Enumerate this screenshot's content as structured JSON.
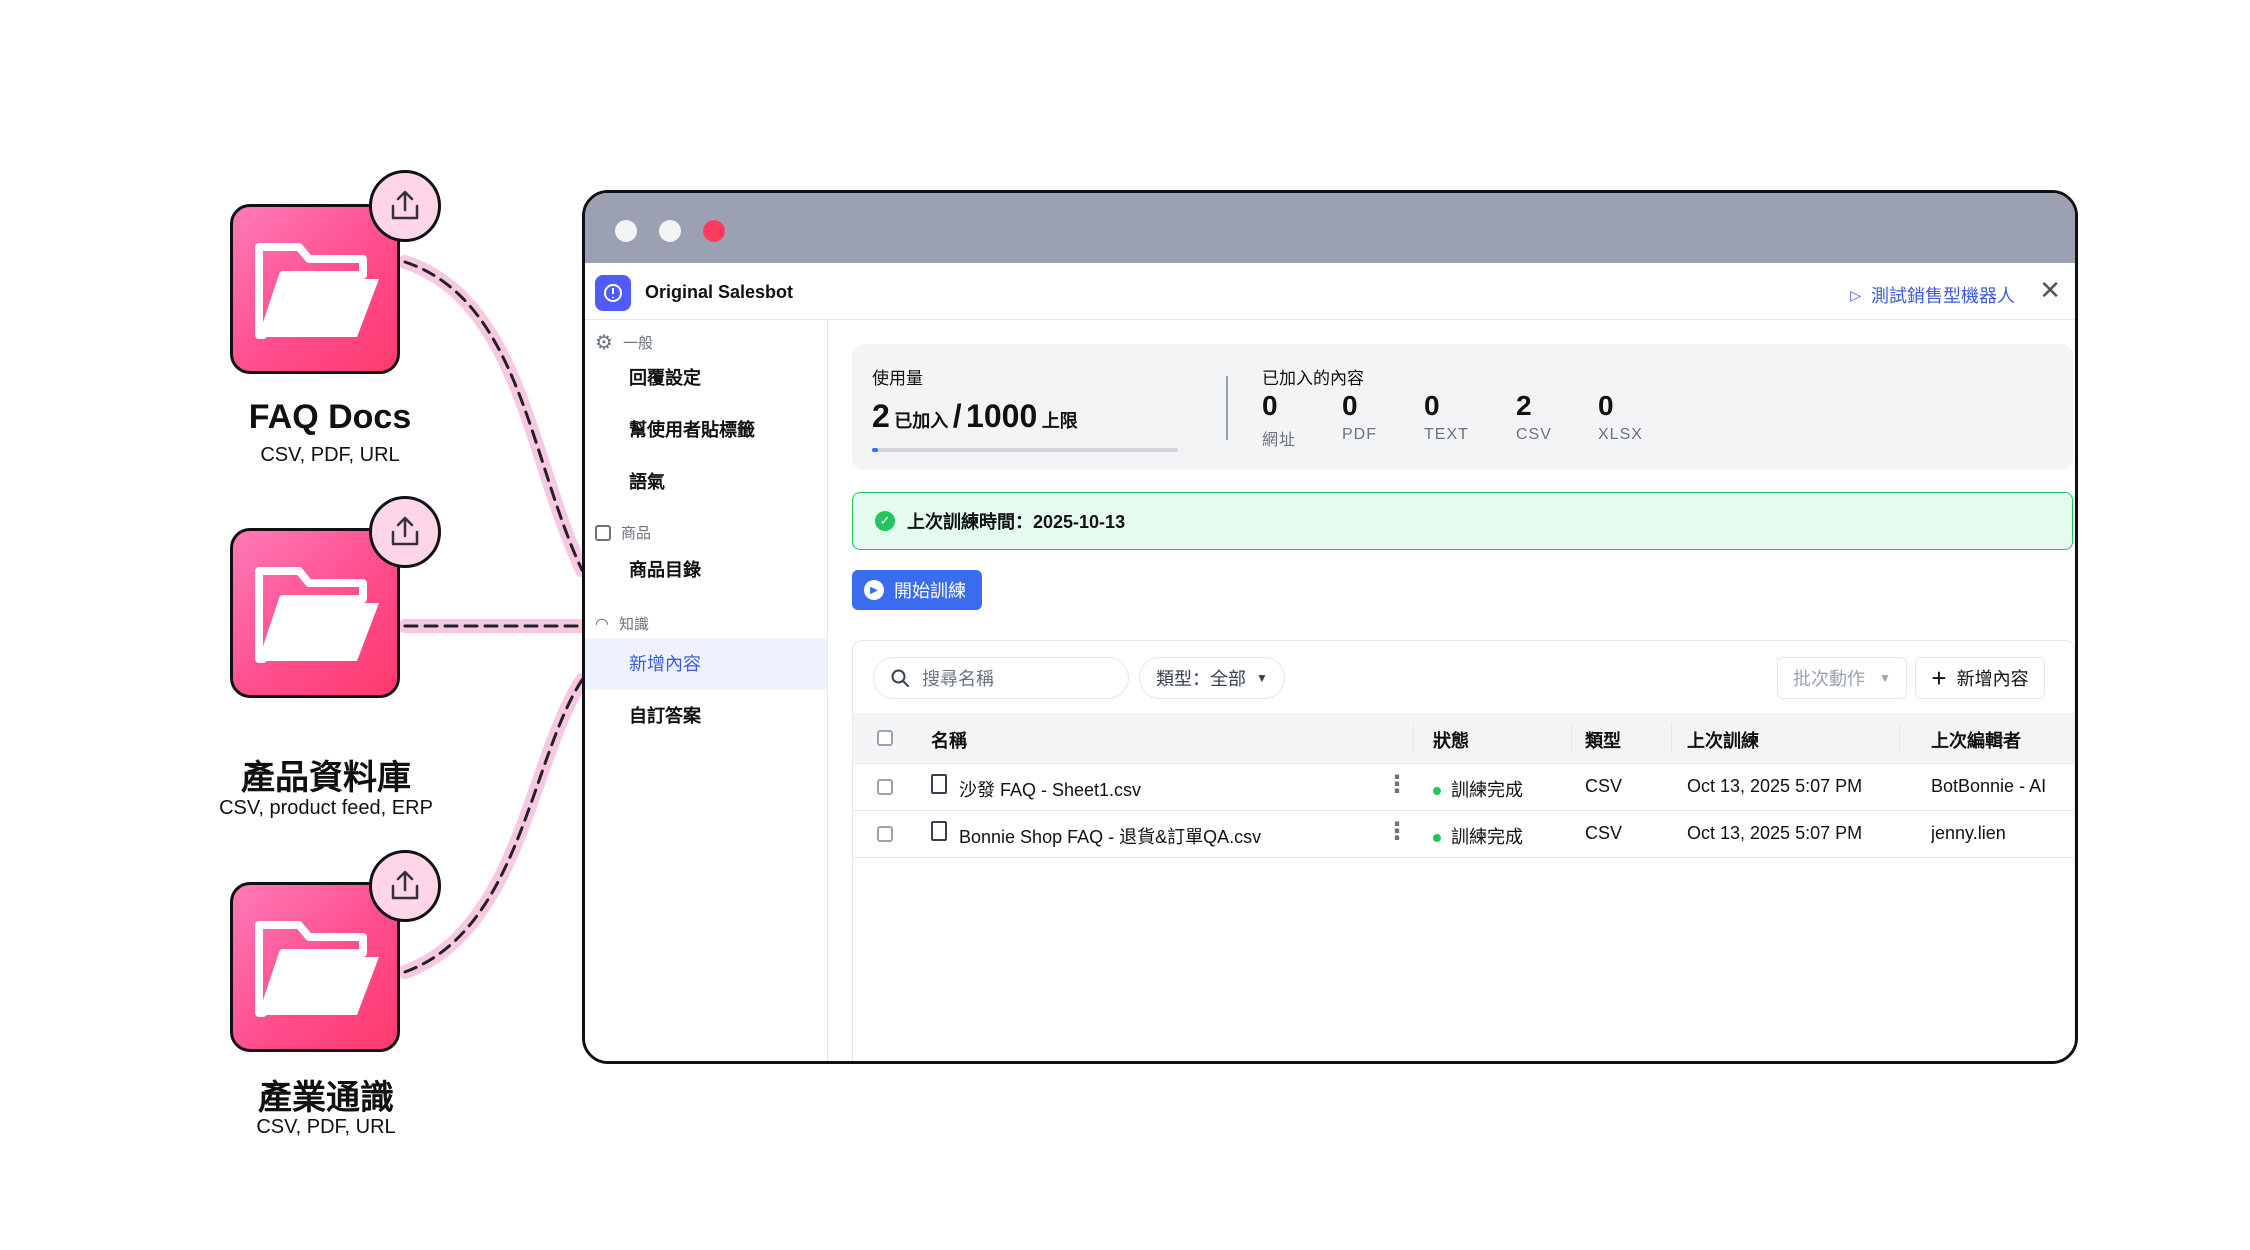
{
  "sources": [
    {
      "title": "FAQ Docs",
      "subtitle": "CSV, PDF, URL",
      "icon": "folder-icon",
      "badge_icon": "upload-icon"
    },
    {
      "title": "產品資料庫",
      "subtitle": "CSV, product feed, ERP",
      "icon": "folder-icon",
      "badge_icon": "upload-icon"
    },
    {
      "title": "產業通識",
      "subtitle": "CSV, PDF, URL",
      "icon": "folder-icon",
      "badge_icon": "upload-icon"
    }
  ],
  "colors": {
    "accent": "#3b6cf0",
    "brand_pink": "#ff4d8d",
    "success": "#22c55e",
    "titlebar": "#9ca0b3",
    "dot_close": "#ff3b5c"
  },
  "app": {
    "name": "Original Salesbot",
    "test_link": "測試銷售型機器人"
  },
  "sidebar": {
    "groups": [
      {
        "label": "一般",
        "icon": "gear-icon"
      },
      {
        "label": "商品",
        "icon": "product-icon"
      },
      {
        "label": "知識",
        "icon": "headset-icon"
      }
    ],
    "items": [
      {
        "label": "回覆設定"
      },
      {
        "label": "幫使用者貼標籤"
      },
      {
        "label": "語氣"
      },
      {
        "label": "商品目錄"
      },
      {
        "label": "新增內容"
      },
      {
        "label": "自訂答案"
      }
    ],
    "active_item": "新增內容"
  },
  "usage": {
    "label": "使用量",
    "used": "2",
    "used_unit": "已加入",
    "limit": "1000",
    "limit_unit": "上限",
    "separator": "/",
    "progress_fraction": 0.002
  },
  "added_content": {
    "label": "已加入的內容",
    "counts": [
      {
        "value": "0",
        "label": "網址"
      },
      {
        "value": "0",
        "label": "PDF"
      },
      {
        "value": "0",
        "label": "TEXT"
      },
      {
        "value": "2",
        "label": "CSV"
      },
      {
        "value": "0",
        "label": "XLSX"
      }
    ]
  },
  "training": {
    "last_trained_text": "上次訓練時間：2025-10-13",
    "start_button": "開始訓練"
  },
  "toolbar": {
    "search_placeholder": "搜尋名稱",
    "type_filter": "類型：全部",
    "batch_action": "批次動作",
    "add_content": "新增內容"
  },
  "table": {
    "columns": [
      "名稱",
      "狀態",
      "類型",
      "上次訓練",
      "上次編輯者"
    ],
    "rows": [
      {
        "name": "沙發 FAQ - Sheet1.csv",
        "status": "訓練完成",
        "type": "CSV",
        "last_trained": "Oct 13, 2025 5:07 PM",
        "editor": "BotBonnie - AI"
      },
      {
        "name": "Bonnie Shop FAQ - 退貨&訂單QA.csv",
        "status": "訓練完成",
        "type": "CSV",
        "last_trained": "Oct 13, 2025 5:07 PM",
        "editor": "jenny.lien"
      }
    ]
  }
}
